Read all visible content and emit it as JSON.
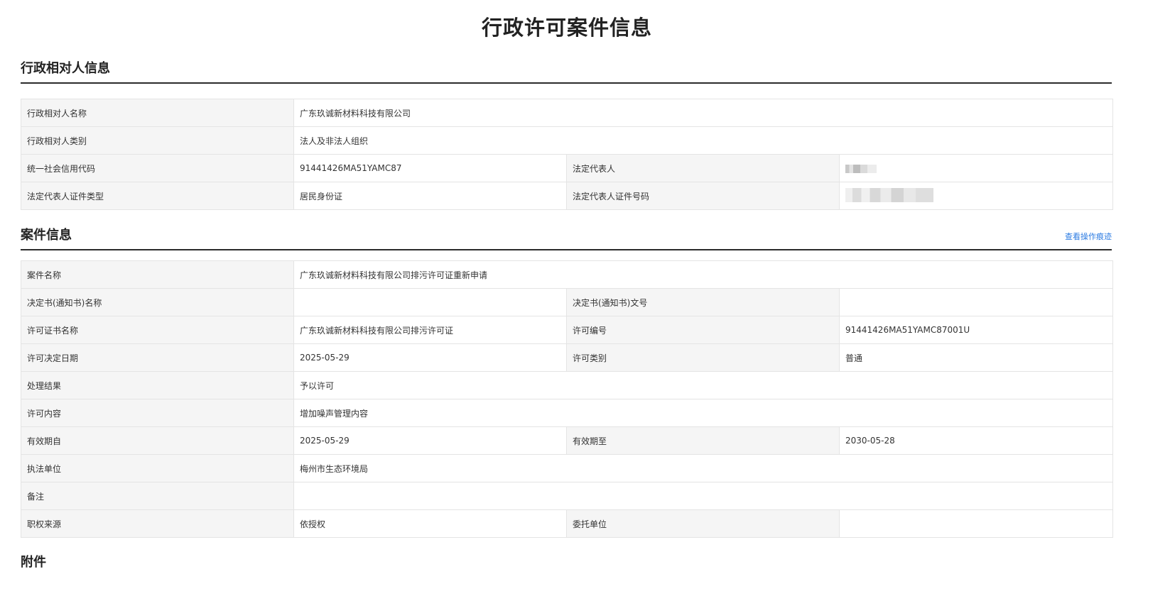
{
  "page": {
    "title": "行政许可案件信息"
  },
  "section1": {
    "title": "行政相对人信息",
    "rows": {
      "name_label": "行政相对人名称",
      "name_value": "广东玖诚新材料科技有限公司",
      "type_label": "行政相对人类别",
      "type_value": "法人及非法人组织",
      "credit_label": "统一社会信用代码",
      "credit_value": "91441426MA51YAMC87",
      "rep_label": "法定代表人",
      "idtype_label": "法定代表人证件类型",
      "idtype_value": "居民身份证",
      "idno_label": "法定代表人证件号码"
    }
  },
  "section2": {
    "title": "案件信息",
    "link": "查看操作痕迹",
    "rows": {
      "case_label": "案件名称",
      "case_value": "广东玖诚新材料科技有限公司排污许可证重新申请",
      "doc_name_label": "决定书(通知书)名称",
      "doc_name_value": "",
      "doc_no_label": "决定书(通知书)文号",
      "doc_no_value": "",
      "lic_name_label": "许可证书名称",
      "lic_name_value": "广东玖诚新材料科技有限公司排污许可证",
      "lic_no_label": "许可编号",
      "lic_no_value": "91441426MA51YAMC87001U",
      "date_label": "许可决定日期",
      "date_value": "2025-05-29",
      "lic_type_label": "许可类别",
      "lic_type_value": "普通",
      "result_label": "处理结果",
      "result_value": "予以许可",
      "content_label": "许可内容",
      "content_value": "增加噪声管理内容",
      "valid_from_label": "有效期自",
      "valid_from_value": "2025-05-29",
      "valid_to_label": "有效期至",
      "valid_to_value": "2030-05-28",
      "unit_label": "执法单位",
      "unit_value": "梅州市生态环境局",
      "remark_label": "备注",
      "remark_value": "",
      "source_label": "职权来源",
      "source_value": "依授权",
      "entrust_label": "委托单位",
      "entrust_value": ""
    }
  },
  "section3": {
    "title": "附件"
  }
}
